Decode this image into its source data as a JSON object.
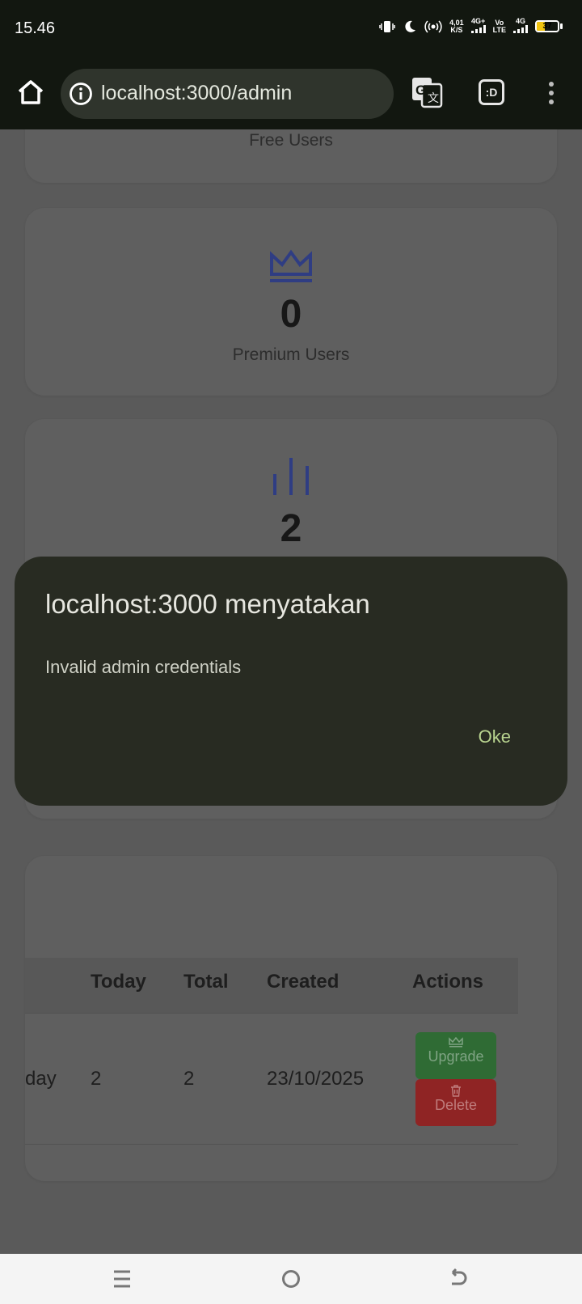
{
  "status_bar": {
    "time": "15.46",
    "net_speed_top": "4,01",
    "net_speed_bottom": "K/S",
    "net1": "4G+",
    "volte_top": "Vo",
    "volte_bottom": "LTE",
    "net2": "4G",
    "battery": "37"
  },
  "browser": {
    "url": "localhost:3000/admin",
    "extension_label": ":D"
  },
  "stats": {
    "free_label": "Free Users",
    "premium_value": "0",
    "premium_label": "Premium Users",
    "third_value": "2"
  },
  "table": {
    "headers": [
      "Today",
      "Total",
      "Created",
      "Actions"
    ],
    "row": {
      "partial_cell": "day",
      "today": "2",
      "total": "2",
      "created": "23/10/2025",
      "upgrade": "Upgrade",
      "delete": "Delete"
    }
  },
  "dialog": {
    "title": "localhost:3000 menyatakan",
    "message": "Invalid admin credentials",
    "ok": "Oke"
  },
  "colors": {
    "accent_ok": "#b8d38f",
    "upgrade": "#2f6b34",
    "delete": "#8f2424",
    "icon_blue": "#2f3d83"
  }
}
